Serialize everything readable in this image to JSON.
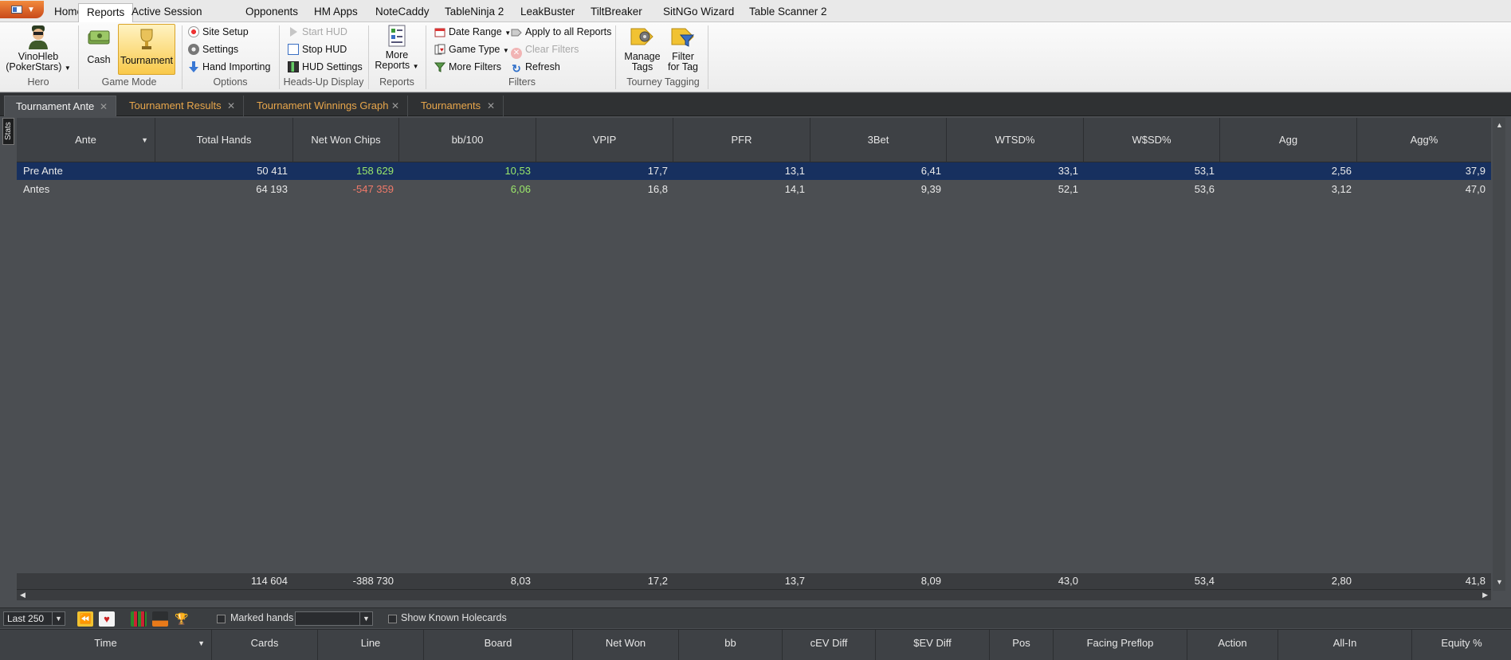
{
  "menu": {
    "items": [
      "Home",
      "Reports",
      "Active Session",
      "Opponents",
      "HM Apps",
      "NoteCaddy",
      "TableNinja 2",
      "LeakBuster",
      "TiltBreaker",
      "SitNGo Wizard",
      "Table Scanner 2"
    ],
    "active": "Reports"
  },
  "ribbon": {
    "hero": {
      "name_line1": "VinoHleb",
      "name_line2": "(PokerStars)",
      "group": "Hero"
    },
    "game_mode": {
      "cash": "Cash",
      "tournament": "Tournament",
      "group": "Game Mode"
    },
    "options": {
      "site_setup": "Site Setup",
      "settings": "Settings",
      "hand_importing": "Hand Importing",
      "group": "Options"
    },
    "hud": {
      "start": "Start HUD",
      "stop": "Stop HUD",
      "settings": "HUD Settings",
      "group": "Heads-Up Display"
    },
    "reports": {
      "more_line1": "More",
      "more_line2": "Reports",
      "group": "Reports"
    },
    "filters": {
      "date_range": "Date Range",
      "game_type": "Game Type",
      "more_filters": "More Filters",
      "apply_all": "Apply to all Reports",
      "clear": "Clear Filters",
      "refresh": "Refresh",
      "group": "Filters"
    },
    "tagging": {
      "manage_line1": "Manage",
      "manage_line2": "Tags",
      "filter_line1": "Filter",
      "filter_line2": "for Tag",
      "group": "Tourney Tagging"
    }
  },
  "tabs": [
    "Tournament Ante",
    "Tournament Results",
    "Tournament Winnings Graph",
    "Tournaments"
  ],
  "side_tab": "Stats",
  "stats": {
    "columns": [
      "Ante",
      "Total Hands",
      "Net Won Chips",
      "bb/100",
      "VPIP",
      "PFR",
      "3Bet",
      "WTSD%",
      "W$SD%",
      "Agg",
      "Agg%"
    ],
    "rows": [
      [
        "Pre Ante",
        "50 411",
        "158 629",
        "10,53",
        "17,7",
        "13,1",
        "6,41",
        "33,1",
        "53,1",
        "2,56",
        "37,9"
      ],
      [
        "Antes",
        "64 193",
        "-547 359",
        "6,06",
        "16,8",
        "14,1",
        "9,39",
        "52,1",
        "53,6",
        "3,12",
        "47,0"
      ]
    ],
    "totals": [
      "",
      "114 604",
      "-388 730",
      "8,03",
      "17,2",
      "13,7",
      "8,09",
      "43,0",
      "53,4",
      "2,80",
      "41,8"
    ]
  },
  "bottom": {
    "filter_value": "Last 250",
    "marked_hands": "Marked hands",
    "show_known": "Show Known Holecards"
  },
  "hands": {
    "columns": [
      "Time",
      "Cards",
      "Line",
      "Board",
      "Net Won",
      "bb",
      "cEV Diff",
      "$EV Diff",
      "Pos",
      "Facing Preflop",
      "Action",
      "All-In",
      "Equity %"
    ]
  },
  "colors": {
    "positive": "#9be86b",
    "negative": "#f07a6a",
    "selected_row": "#17305f",
    "tab_orange": "#e8a64b"
  }
}
